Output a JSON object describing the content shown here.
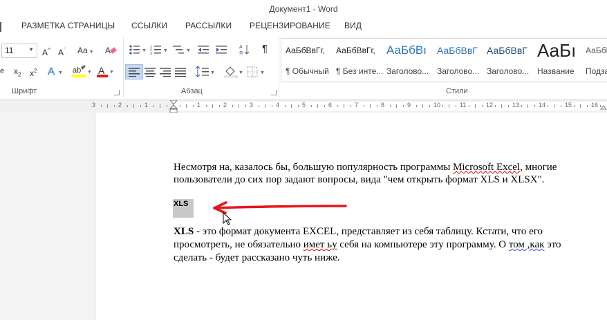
{
  "window": {
    "title": "Документ1 - Word"
  },
  "tabs": [
    "РАЗМЕТКА СТРАНИЦЫ",
    "ССЫЛКИ",
    "РАССЫЛКИ",
    "РЕЦЕНЗИРОВАНИЕ",
    "ВИД"
  ],
  "ribbon": {
    "font_group": {
      "label": "Шрифт",
      "font_size": "11",
      "change_case": "Aa"
    },
    "paragraph_group": {
      "label": "Абзац"
    },
    "styles_group": {
      "label": "Стили",
      "items": [
        {
          "preview": "АаБбВвГг,",
          "name": "¶ Обычный"
        },
        {
          "preview": "АаБбВвГг,",
          "name": "¶ Без инте..."
        },
        {
          "preview": "АаБбВı",
          "name": "Заголово..."
        },
        {
          "preview": "АаБбВвГ",
          "name": "Заголово..."
        },
        {
          "preview": "АаБбВвГ",
          "name": "Заголово..."
        },
        {
          "preview": "АаБı",
          "name": "Название"
        },
        {
          "preview": "АаБбВвГ",
          "name": "Подза"
        }
      ]
    }
  },
  "ruler": {
    "numbers": [
      "3",
      "2",
      "1",
      "1",
      "2",
      "3",
      "4",
      "5",
      "6",
      "7",
      "8",
      "9",
      "10",
      "11",
      "12",
      "13",
      "14",
      "15",
      "16"
    ]
  },
  "document": {
    "para1_line1_a": "Несмотря на, казалось бы, большую популярность программы ",
    "para1_line1_b": "Microsoft Excel",
    "para1_line1_c": ", многие",
    "para1_line2": "пользователи до сих пор задают вопросы, вида \"чем открыть формат XLS и XLSX\".",
    "heading": "XLS",
    "para2_line1_bold": "XLS",
    "para2_line1_rest": " - это формат документа EXCEL, представляет из себя таблицу. Кстати, что его",
    "para2_line2_a": "просмотреть, не обязательно ",
    "para2_line2_b": "имет ьу",
    "para2_line2_c": " себя на компьютере эту программу. О ",
    "para2_line2_d": "том ,как",
    "para2_line2_e": " это",
    "para2_line3": "сделать - будет рассказано чуть ниже."
  },
  "colors": {
    "arrow": "#e8141c",
    "highlight": "#c8c8c8",
    "accent": "#2b579a"
  }
}
